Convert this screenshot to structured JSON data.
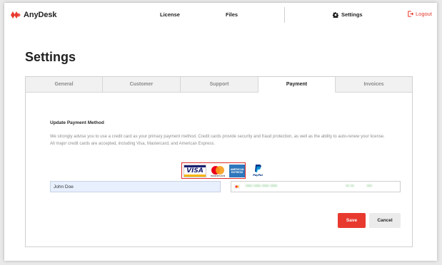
{
  "header": {
    "brand": "AnyDesk",
    "nav": {
      "license": "License",
      "files": "Files",
      "settings": "Settings",
      "logout": "Logout"
    }
  },
  "page": {
    "title": "Settings"
  },
  "tabs": [
    {
      "label": "General",
      "active": false
    },
    {
      "label": "Customer",
      "active": false
    },
    {
      "label": "Support",
      "active": false
    },
    {
      "label": "Payment",
      "active": true
    },
    {
      "label": "Invoices",
      "active": false
    }
  ],
  "payment": {
    "section_title": "Update Payment Method",
    "description": "We strongly advise you to use a credit card as your primary payment method. Credit cards provide security and fraud protection, as well as the ability to auto-renew your license. All major credit cards are accepted, including Visa, Mastercard, and American Express.",
    "cards": {
      "visa": "VISA",
      "mastercard": "mastercard",
      "amex": "AMERICAN EXPRESS",
      "paypal": "PayPal"
    },
    "name_value": "John Doe",
    "card_number_masked": "•••• •••• •••• ••••",
    "card_expiry_masked": "•• ••",
    "card_cvc_masked": "•••"
  },
  "buttons": {
    "save": "Save",
    "cancel": "Cancel"
  },
  "colors": {
    "accent": "#e8392f",
    "highlight_box": "#e02a2a",
    "tab_active": "#ffffff",
    "tab_inactive": "#f1f1f1"
  }
}
